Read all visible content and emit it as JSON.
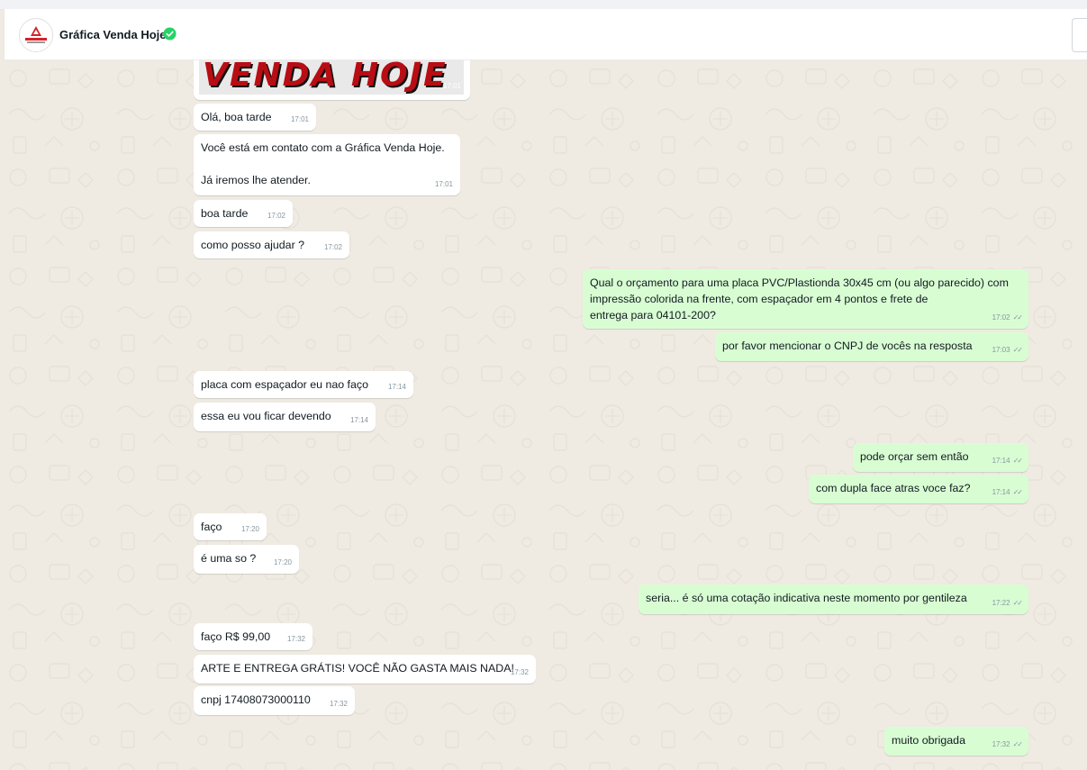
{
  "header": {
    "contact_name": "Gráfica Venda Hoje",
    "verified_icon": "verified-check-icon",
    "avatar_logo_text": "VENDA HOJE",
    "colors": {
      "verified": "#25d366",
      "logo_red": "#d2232a"
    }
  },
  "image_message": {
    "banner_text": "VENDA HOJE",
    "time": "17:01"
  },
  "messages": [
    {
      "dir": "in",
      "text": "Olá, boa tarde",
      "time": "17:01"
    },
    {
      "dir": "in",
      "text": "Você está em contato com a Gráfica Venda Hoje.\n\nJá iremos lhe atender.",
      "time": "17:01"
    },
    {
      "dir": "in",
      "text": "boa tarde",
      "time": "17:02"
    },
    {
      "dir": "in",
      "text": "como posso ajudar ?",
      "time": "17:02"
    },
    {
      "dir": "out",
      "text": "Qual o orçamento para uma placa PVC/Plastionda 30x45 cm (ou algo parecido) com\nimpressão colorida na frente, com espaçador em 4 pontos e frete de\nentrega para 04101-200?",
      "time": "17:02"
    },
    {
      "dir": "out",
      "text": "por favor mencionar o CNPJ de vocês na resposta",
      "time": "17:03"
    },
    {
      "dir": "in",
      "text": "placa com espaçador eu nao faço",
      "time": "17:14"
    },
    {
      "dir": "in",
      "text": "essa eu vou ficar devendo",
      "time": "17:14"
    },
    {
      "dir": "out",
      "text": "pode orçar sem então",
      "time": "17:14"
    },
    {
      "dir": "out",
      "text": "com dupla face atras voce faz?",
      "time": "17:14"
    },
    {
      "dir": "in",
      "text": "faço",
      "time": "17:20"
    },
    {
      "dir": "in",
      "text": "é uma so ?",
      "time": "17:20"
    },
    {
      "dir": "out",
      "text": "seria... é só uma cotação indicativa neste momento por gentileza",
      "time": "17:22"
    },
    {
      "dir": "in",
      "text": "faço R$ 99,00",
      "time": "17:32"
    },
    {
      "dir": "in",
      "text": "ARTE E ENTREGA GRÁTIS! VOCÊ NÃO GASTA MAIS NADA!",
      "time": "17:32"
    },
    {
      "dir": "in",
      "text": "cnpj 17408073000110",
      "time": "17:32"
    },
    {
      "dir": "out",
      "text": "muito obrigada",
      "time": "17:32"
    }
  ],
  "read_receipt_icon": "double-check-icon",
  "colors": {
    "incoming_bubble": "#ffffff",
    "outgoing_bubble": "#d9fdd3",
    "chat_bg": "#efeae2"
  }
}
